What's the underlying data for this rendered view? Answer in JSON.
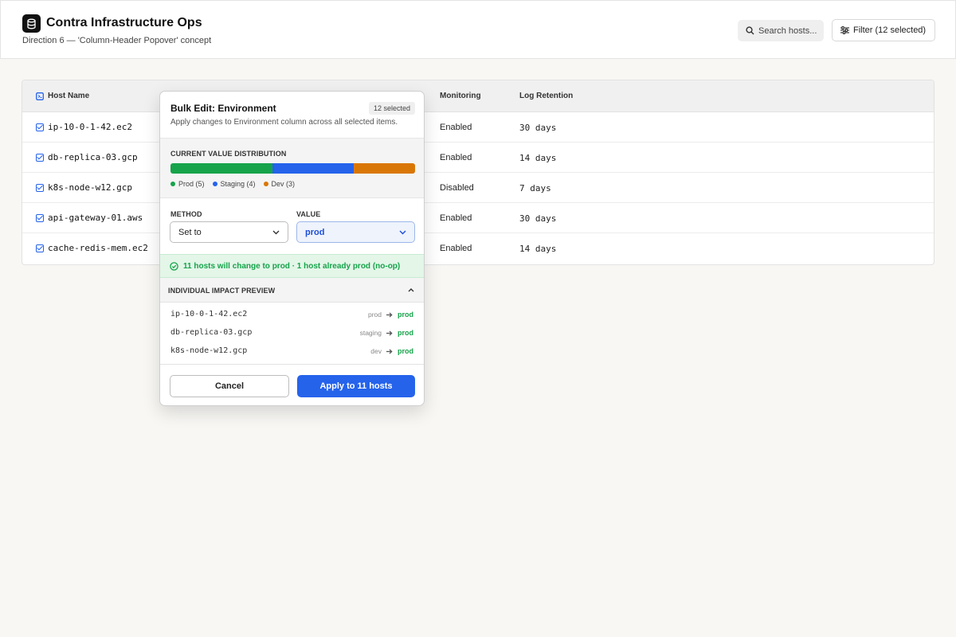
{
  "header": {
    "title": "Contra Infrastructure Ops",
    "subtitle": "Direction 6 — 'Column-Header Popover' concept",
    "search_placeholder": "Search hosts...",
    "filter_label": "Filter (12 selected)"
  },
  "table": {
    "columns": {
      "host_name": "Host Name",
      "monitoring": "Monitoring",
      "log_retention": "Log Retention"
    },
    "rows": [
      {
        "host": "ip-10-0-1-42.ec2",
        "monitoring": "Enabled",
        "log_retention": "30 days"
      },
      {
        "host": "db-replica-03.gcp",
        "monitoring": "Enabled",
        "log_retention": "14 days"
      },
      {
        "host": "k8s-node-w12.gcp",
        "monitoring": "Disabled",
        "log_retention": "7 days"
      },
      {
        "host": "api-gateway-01.aws",
        "monitoring": "Enabled",
        "log_retention": "30 days"
      },
      {
        "host": "cache-redis-mem.ec2",
        "monitoring": "Enabled",
        "log_retention": "14 days"
      }
    ]
  },
  "popover": {
    "title": "Bulk Edit: Environment",
    "badge": "12 selected",
    "description": "Apply changes to Environment column across all selected items.",
    "distribution": {
      "label": "CURRENT VALUE DISTRIBUTION",
      "segments": [
        {
          "label": "Prod (5)",
          "count": 5,
          "color": "#16a34a"
        },
        {
          "label": "Staging (4)",
          "count": 4,
          "color": "#2563eb"
        },
        {
          "label": "Dev (3)",
          "count": 3,
          "color": "#d97706"
        }
      ]
    },
    "method_label": "METHOD",
    "method_value": "Set to",
    "value_label": "VALUE",
    "value_value": "prod",
    "status_text": "11 hosts will change to prod · 1 host already prod (no-op)",
    "impact_label": "INDIVIDUAL IMPACT PREVIEW",
    "impact_rows": [
      {
        "host": "ip-10-0-1-42.ec2",
        "from": "prod",
        "to": "prod"
      },
      {
        "host": "db-replica-03.gcp",
        "from": "staging",
        "to": "prod"
      },
      {
        "host": "k8s-node-w12.gcp",
        "from": "dev",
        "to": "prod"
      }
    ],
    "cancel_label": "Cancel",
    "apply_label": "Apply to 11 hosts"
  },
  "colors": {
    "accent": "#2563eb",
    "success": "#16a34a",
    "warning": "#d97706"
  },
  "icons": {
    "logo": "database-icon",
    "search": "search-icon",
    "filter": "sliders-icon",
    "header_col": "column-icon",
    "row_checkbox": "checkbox-checked-icon",
    "status": "check-circle-icon",
    "collapse": "chevron-up-icon",
    "arrow": "arrow-right-icon"
  }
}
